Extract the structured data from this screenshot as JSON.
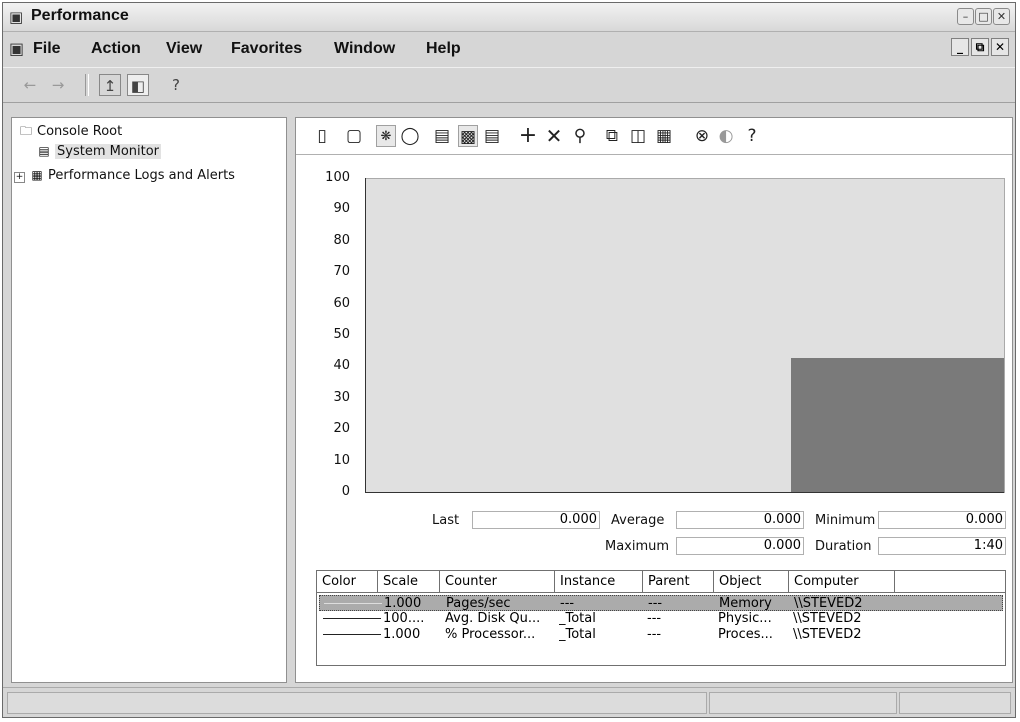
{
  "window": {
    "title": "Performance"
  },
  "menu": {
    "items": [
      "File",
      "Action",
      "View",
      "Favorites",
      "Window",
      "Help"
    ]
  },
  "nav": {
    "icons": [
      "back-arrow-icon",
      "forward-arrow-icon",
      "up-folder-icon",
      "show-hide-tree-icon",
      "help-icon"
    ]
  },
  "tree": {
    "items": [
      {
        "label": "Console Root",
        "icon": "folder-icon"
      },
      {
        "label": "System Monitor",
        "icon": "system-monitor-icon",
        "selected": true
      },
      {
        "label": "Performance Logs and Alerts",
        "icon": "logs-alerts-icon",
        "expander": "+"
      }
    ]
  },
  "toolbar": {
    "icons": [
      "new-counter-set-icon",
      "clear-display-icon",
      "view-current-activity-icon",
      "view-log-data-icon",
      "view-graph-icon",
      "view-histogram-icon",
      "view-report-icon",
      "add-icon",
      "delete-icon",
      "highlight-icon",
      "copy-properties-icon",
      "paste-counter-list-icon",
      "properties-icon",
      "freeze-display-icon",
      "update-data-icon",
      "help-icon"
    ]
  },
  "chart_data": {
    "type": "bar",
    "ylim": [
      0,
      100
    ],
    "yticks": [
      "100",
      "90",
      "80",
      "70",
      "60",
      "50",
      "40",
      "30",
      "20",
      "10",
      "0"
    ],
    "series": [
      {
        "name": "Pages/sec",
        "value": 0
      },
      {
        "name": "Avg. Disk Qu...",
        "value": 0
      },
      {
        "name": "% Processor...",
        "value": 43
      }
    ],
    "colors": {
      "plot_bg": "#e0e0e0",
      "bar": "#7a7a7a"
    }
  },
  "stats": {
    "last_label": "Last",
    "last_value": "0.000",
    "average_label": "Average",
    "average_value": "0.000",
    "minimum_label": "Minimum",
    "minimum_value": "0.000",
    "maximum_label": "Maximum",
    "maximum_value": "0.000",
    "duration_label": "Duration",
    "duration_value": "1:40"
  },
  "legend": {
    "headers": [
      "Color",
      "Scale",
      "Counter",
      "Instance",
      "Parent",
      "Object",
      "Computer"
    ],
    "rows": [
      {
        "scale": "1.000",
        "counter": "Pages/sec",
        "instance": "---",
        "parent": "---",
        "object": "Memory",
        "computer": "\\\\STEVED2",
        "selected": true
      },
      {
        "scale": "100....",
        "counter": "Avg. Disk Qu...",
        "instance": "_Total",
        "parent": "---",
        "object": "Physic...",
        "computer": "\\\\STEVED2"
      },
      {
        "scale": "1.000",
        "counter": "% Processor...",
        "instance": "_Total",
        "parent": "---",
        "object": "Proces...",
        "computer": "\\\\STEVED2"
      }
    ]
  }
}
